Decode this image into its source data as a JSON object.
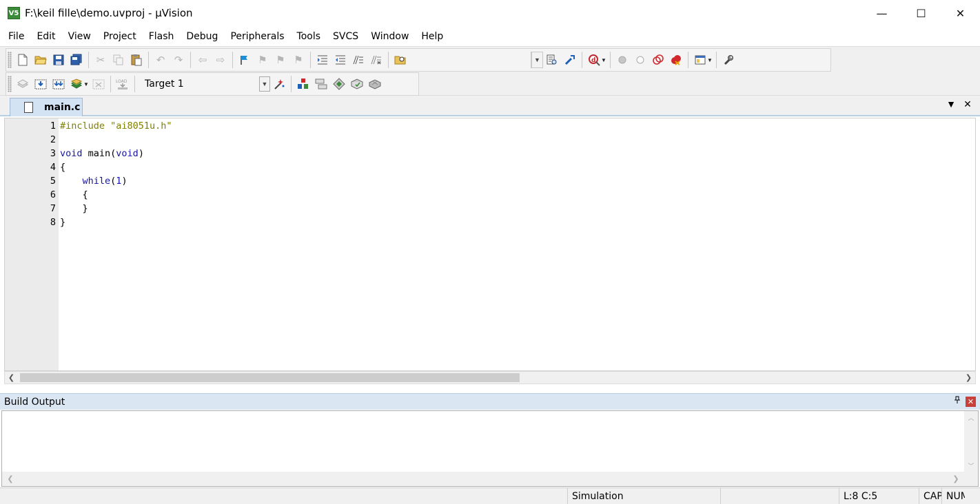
{
  "window": {
    "title": "F:\\keil fille\\demo.uvproj - µVision",
    "app_icon_text": "V5",
    "minimize": "—",
    "maximize": "☐",
    "close": "✕"
  },
  "menu": [
    "File",
    "Edit",
    "View",
    "Project",
    "Flash",
    "Debug",
    "Peripherals",
    "Tools",
    "SVCS",
    "Window",
    "Help"
  ],
  "toolbar2": {
    "target_select": "Target 1",
    "load_icon_text": "LOAD"
  },
  "tab": {
    "label": "main.c",
    "dropdown": "▼",
    "close": "✕"
  },
  "editor": {
    "lines": [
      {
        "num": "1",
        "tokens": [
          {
            "t": "#include \"ai8051u.h\"",
            "c": "pp"
          }
        ]
      },
      {
        "num": "2",
        "tokens": []
      },
      {
        "num": "3",
        "tokens": [
          {
            "t": "void",
            "c": "kw"
          },
          {
            "t": " main(",
            "c": ""
          },
          {
            "t": "void",
            "c": "kw"
          },
          {
            "t": ")",
            "c": ""
          }
        ]
      },
      {
        "num": "4",
        "tokens": [
          {
            "t": "{",
            "c": ""
          }
        ]
      },
      {
        "num": "5",
        "tokens": [
          {
            "t": "    ",
            "c": ""
          },
          {
            "t": "while",
            "c": "kw"
          },
          {
            "t": "(",
            "c": ""
          },
          {
            "t": "1",
            "c": "num"
          },
          {
            "t": ")",
            "c": ""
          }
        ]
      },
      {
        "num": "6",
        "tokens": [
          {
            "t": "    {",
            "c": ""
          }
        ]
      },
      {
        "num": "7",
        "tokens": [
          {
            "t": "    }",
            "c": ""
          }
        ]
      },
      {
        "num": "8",
        "tokens": [
          {
            "t": "}",
            "c": ""
          }
        ]
      }
    ]
  },
  "build_output": {
    "title": "Build Output",
    "pin": "📌",
    "close": "✕"
  },
  "status": {
    "mode": "Simulation",
    "position": "L:8 C:5",
    "cap": "CAP",
    "num": "NUM"
  },
  "colors": {
    "keyword": "#1515a3",
    "preprocessor": "#808000",
    "tab_active": "#d3e3f3",
    "panel_header": "#dbe6f3"
  }
}
